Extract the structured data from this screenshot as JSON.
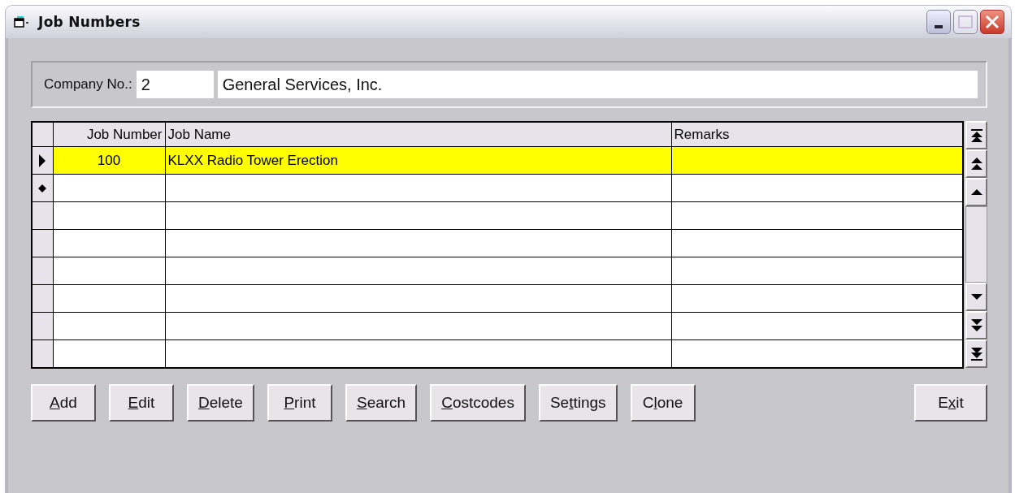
{
  "window": {
    "title": "Job Numbers"
  },
  "company": {
    "label": "Company No.:",
    "number": "2",
    "name": "General Services, Inc."
  },
  "table": {
    "columns": [
      "Job Number",
      "Job Name",
      "Remarks"
    ],
    "rows": [
      {
        "kind": "current",
        "selected": true,
        "cells": [
          "100",
          "KLXX Radio Tower Erection",
          ""
        ]
      },
      {
        "kind": "new",
        "selected": false,
        "cells": [
          "",
          "",
          ""
        ]
      },
      {
        "kind": "blank",
        "selected": false,
        "cells": [
          "",
          "",
          ""
        ]
      },
      {
        "kind": "blank",
        "selected": false,
        "cells": [
          "",
          "",
          ""
        ]
      },
      {
        "kind": "blank",
        "selected": false,
        "cells": [
          "",
          "",
          ""
        ]
      },
      {
        "kind": "blank",
        "selected": false,
        "cells": [
          "",
          "",
          ""
        ]
      },
      {
        "kind": "blank",
        "selected": false,
        "cells": [
          "",
          "",
          ""
        ]
      },
      {
        "kind": "blank",
        "selected": false,
        "cells": [
          "",
          "",
          ""
        ]
      }
    ]
  },
  "buttons": [
    {
      "key": "A",
      "after": "dd"
    },
    {
      "key": "E",
      "after": "dit"
    },
    {
      "key": "D",
      "after": "elete"
    },
    {
      "key": "P",
      "after": "rint"
    },
    {
      "key": "S",
      "after": "earch"
    },
    {
      "key": "C",
      "after": "ostcodes"
    },
    {
      "before": "Se",
      "key": "t",
      "after": "tings"
    },
    {
      "before": "C",
      "key": "l",
      "after": "one"
    }
  ],
  "exit_button": {
    "before": "E",
    "key": "x",
    "after": "it"
  }
}
